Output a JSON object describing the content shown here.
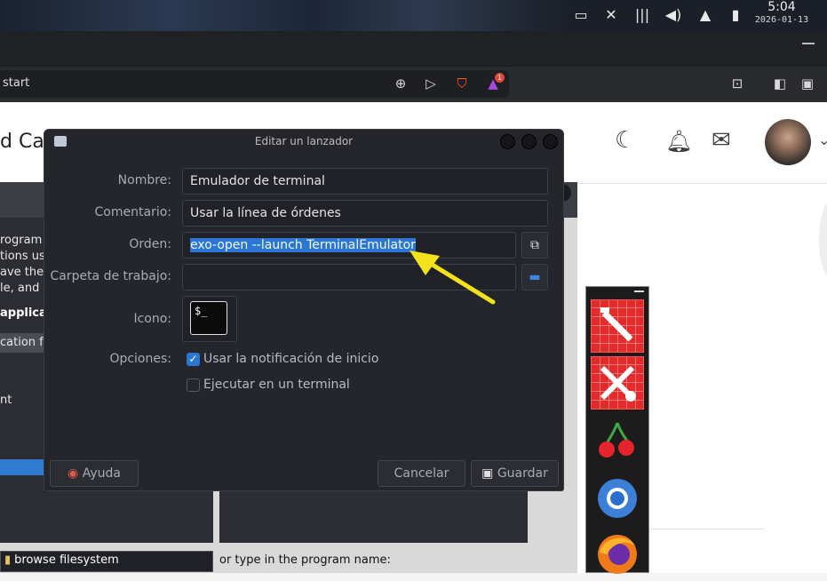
{
  "top_panel": {
    "clock_time": "5:04",
    "clock_date": "2026-01-13",
    "tray_icons": [
      "window-icon",
      "network-off-icon",
      "equalizer-icon",
      "volume-icon",
      "notification-bell-icon",
      "battery-icon"
    ]
  },
  "browser": {
    "url_text": "start",
    "toolbar_icons": [
      "zoom-icon",
      "send-icon",
      "brave-shields-icon",
      "brave-rewards-icon",
      "screenshot-icon",
      "sidebar-icon",
      "wallet-icon"
    ],
    "rewards_badge": "1"
  },
  "page": {
    "partial_title": "d Ca",
    "header_icons": [
      "moon-icon",
      "bell-icon",
      "mail-icon"
    ]
  },
  "background_app": {
    "text_lines": [
      "rogram",
      "tions us",
      "ave their",
      "le, and r"
    ],
    "bold_line": "applica",
    "strip_text": "cation f",
    "item_text": "nt",
    "browse_button": "browse filesystem",
    "type_prompt": "or type in the program name:"
  },
  "dialog": {
    "title": "Editar un lanzador",
    "labels": {
      "name": "Nombre:",
      "comment": "Comentario:",
      "command": "Orden:",
      "workdir": "Carpeta de trabajo:",
      "icon": "Icono:",
      "options": "Opciones:"
    },
    "values": {
      "name": "Emulador de terminal",
      "comment": "Usar la línea de órdenes",
      "command": "exo-open --launch TerminalEmulator",
      "workdir": ""
    },
    "icon_preview_text": "$_",
    "options": [
      {
        "label": "Usar la notificación de inicio",
        "checked": true
      },
      {
        "label": "Ejecutar en un terminal",
        "checked": false
      }
    ],
    "buttons": {
      "help": "Ayuda",
      "cancel": "Cancelar",
      "save": "Guardar"
    }
  },
  "colors": {
    "dialog_bg": "#24262c",
    "selection": "#2a76d2",
    "annotation_arrow": "#f2e21b"
  }
}
